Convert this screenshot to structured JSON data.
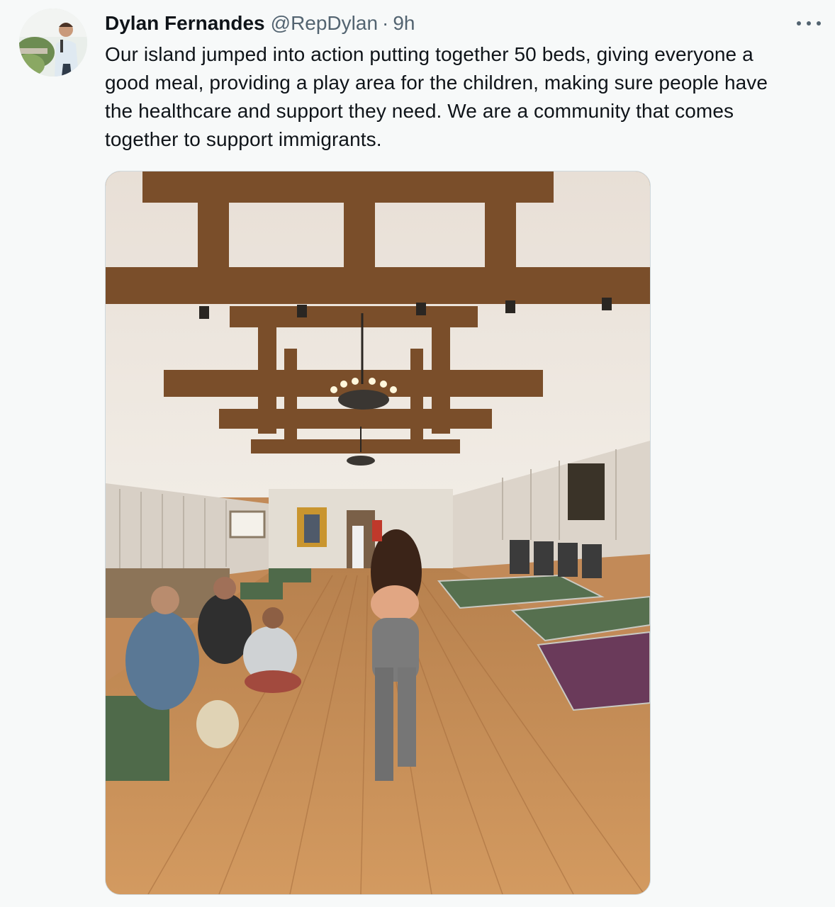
{
  "tweet": {
    "author_name": "Dylan Fernandes",
    "handle": "@RepDylan",
    "separator": "·",
    "time": "9h",
    "text": "Our island jumped into action putting together 50 beds, giving everyone a\ngood meal, providing a play area for the children, making sure people have\nthe healthcare and support they need. We are a community that comes\ntogether to support immigrants."
  },
  "icons": {
    "more": "more-horizontal-icon"
  },
  "colors": {
    "background": "#f7f9f9",
    "text_primary": "#0f1419",
    "text_secondary": "#536471",
    "media_border": "#cfd9de"
  }
}
